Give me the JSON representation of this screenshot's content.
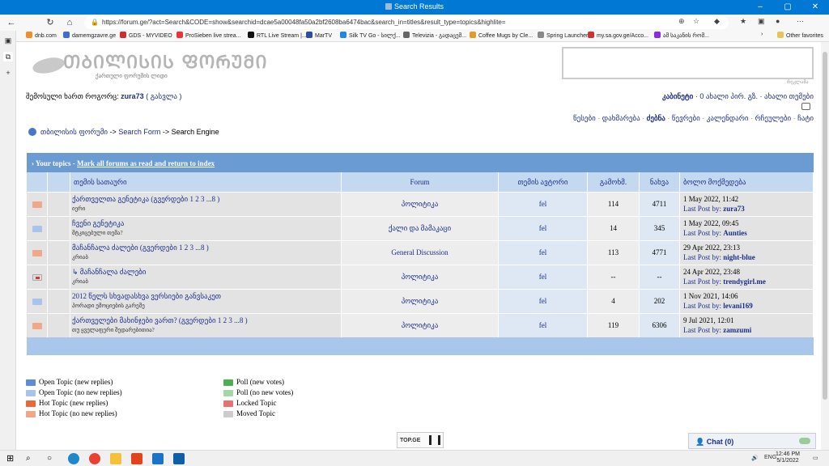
{
  "window": {
    "title": "Search Results"
  },
  "address": {
    "url": "https://forum.ge/?act=Search&CODE=show&searchid=dcae5a00048fa50a2bf2608ba6474bac&search_in=titles&result_type=topics&highlite="
  },
  "favorites": [
    {
      "label": "dnb.com",
      "color": "#f28c28"
    },
    {
      "label": "damemgzavre.ge",
      "color": "#3c6fd1"
    },
    {
      "label": "GDS - MYVIDEO",
      "color": "#d12b2b"
    },
    {
      "label": "ProSieben live strea...",
      "color": "#e33"
    },
    {
      "label": "RTL Live Stream |...",
      "color": "#111"
    },
    {
      "label": "MarTV",
      "color": "#2a4fa0"
    },
    {
      "label": "Silk TV Go - სილქ...",
      "color": "#1e88e5"
    },
    {
      "label": "Televizia - გადაცემ...",
      "color": "#666"
    },
    {
      "label": "Coffee Mugs by Cle...",
      "color": "#e69a2a"
    },
    {
      "label": "Spring Launcher",
      "color": "#888"
    },
    {
      "label": "my.sa.gov.ge/Acco...",
      "color": "#c33"
    },
    {
      "label": "ამ საკანის რომ...",
      "color": "#8a2be2"
    }
  ],
  "favorites_other": "Other favorites",
  "logo": {
    "big": "ᲗᲑᲘᲚᲘᲡᲘᲡ ᲤᲝᲠᲣᲛᲘ",
    "small": "ქართული ფორუმის ლიდი",
    "ad_tag": "რეკლამა"
  },
  "user": {
    "prefix": "შემოსული ხართ როგორც:",
    "name": "zura73",
    "logout": "( გასვლა )"
  },
  "usernav": {
    "cabinet": "კაბინეტი",
    "rest": " · 0 ახალი პირ. გზ. · ახალი თემები"
  },
  "mainnav": [
    "წესები",
    "დახმარება",
    "ძებნა",
    "წევრები",
    "კალენდარი",
    "რჩეულები",
    "ჩატი"
  ],
  "breadcrumb": {
    "forum": "თბილისის ფორუმი",
    "a1": " -> ",
    "search": "Search Form",
    "a2": " -> ",
    "engine": "Search Engine"
  },
  "table": {
    "header": {
      "prefix": "›",
      "title": "Your topics",
      "sep": " - ",
      "link": "Mark all forums as read and return to index"
    },
    "columns": [
      "თემის სათაური",
      "Forum",
      "თემის ავტორი",
      "გამოხმ.",
      "ნახვა",
      "ბოლო მოქმედება"
    ],
    "last_prefix": "Last Post by: ",
    "rows": [
      {
        "icon": "hot",
        "title": "ქართველთა გენეტიკა",
        "pages": " (გვერდები 1 2 3 ...8 )",
        "desc": "იერი",
        "forum": "პოლიტიკა",
        "starter": "fel",
        "replies": "114",
        "views": "4711",
        "date": "1 May 2022, 11:42",
        "last": "zura73"
      },
      {
        "icon": "open",
        "title": "ჩვენი გენეტიკა",
        "pages": "",
        "desc": "მტკიცებული თემა?",
        "forum": "ქალი და მამაკაცი",
        "starter": "fel",
        "replies": "14",
        "views": "345",
        "date": "1 May 2022, 09:45",
        "last": "Aunties"
      },
      {
        "icon": "hot",
        "title": "მაჩანჩალა ძალები",
        "pages": " (გვერდები 1 2 3 ...8 )",
        "desc": "კრიაბ",
        "forum": "General Discussion",
        "starter": "fel",
        "replies": "113",
        "views": "4771",
        "date": "29 Apr 2022, 23:13",
        "last": "night-blue"
      },
      {
        "icon": "moved",
        "title": "მაჩანჩალა ძალები",
        "pages": "",
        "desc": "კრიაბ",
        "forum": "პოლიტიკა",
        "starter": "fel",
        "replies": "--",
        "views": "--",
        "date": "24 Apr 2022, 23:48",
        "last": "trendygirl.me"
      },
      {
        "icon": "open",
        "title": "2012 წელს სხვადასხვა ვერსიები განვსაკეთ",
        "pages": "",
        "desc": "პორადი ემოციების გარეშე",
        "forum": "პოლიტიკა",
        "starter": "fel",
        "replies": "4",
        "views": "202",
        "date": "1 Nov 2021, 14:06",
        "last": "levani169"
      },
      {
        "icon": "hot",
        "title": "ქართველები მახინჯები ვართ?",
        "pages": " (გვერდები 1 2 3 ...8 )",
        "desc": "თუ ყველაფერი შედარებითია?",
        "forum": "პოლიტიკა",
        "starter": "fel",
        "replies": "119",
        "views": "6306",
        "date": "9 Jul 2021, 12:01",
        "last": "zamzumi"
      }
    ]
  },
  "legend": {
    "left": [
      {
        "label": "Open Topic (new replies)",
        "color": "#5b8ed6"
      },
      {
        "label": "Open Topic (no new replies)",
        "color": "#a8c4ea"
      },
      {
        "label": "Hot Topic (new replies)",
        "color": "#e86a3a"
      },
      {
        "label": "Hot Topic (no new replies)",
        "color": "#f0a88a"
      }
    ],
    "right": [
      {
        "label": "Poll (new votes)",
        "color": "#4caf50"
      },
      {
        "label": "Poll (no new votes)",
        "color": "#a5d6a7"
      },
      {
        "label": "Locked Topic",
        "color": "#e57373"
      },
      {
        "label": "Moved Topic",
        "color": "#cccccc"
      }
    ]
  },
  "topge": "TOP.GE",
  "chat": {
    "label": "Chat",
    "count": "(0)"
  },
  "tray": {
    "lang": "ENG",
    "time": "12:46 PM",
    "date": "5/1/2022"
  }
}
